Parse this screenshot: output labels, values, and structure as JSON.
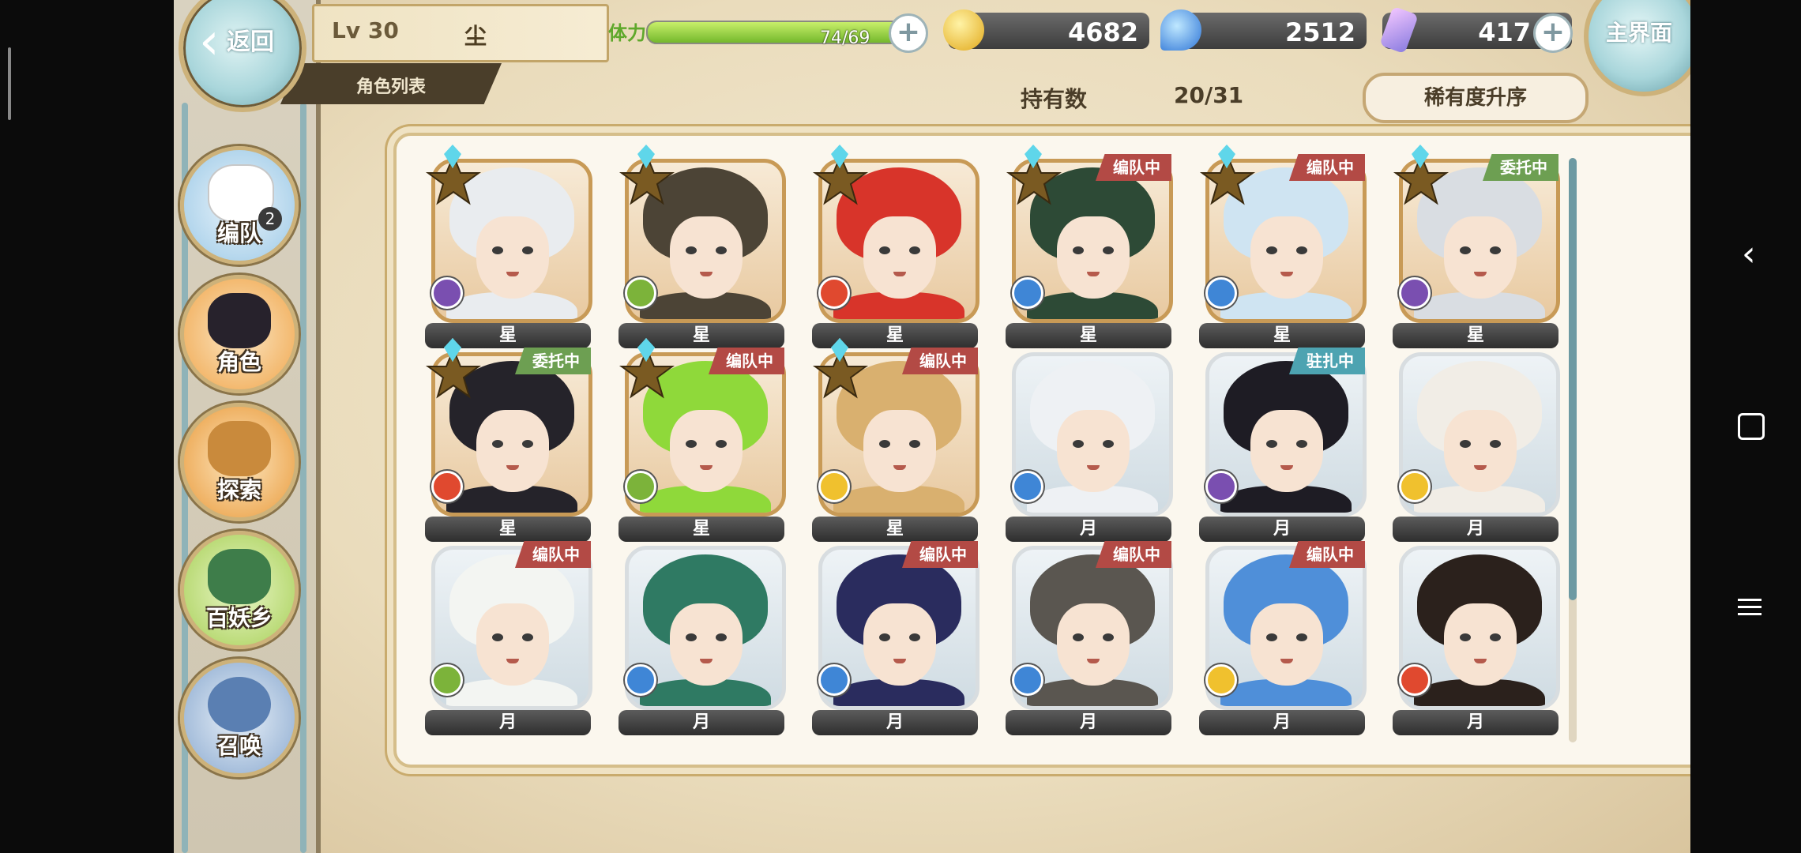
{
  "header": {
    "back_label": "返回",
    "home_label": "主界面",
    "level": "Lv 30",
    "player_name": "尘",
    "section_title": "角色列表",
    "stamina_label": "体力",
    "stamina_value": "74/69",
    "stamina_fraction": 0.93,
    "gold": "4682",
    "spirit": "2512",
    "crystal": "417"
  },
  "toolbar": {
    "owned_label": "持有数",
    "owned_value": "20/31",
    "sort_label": "稀有度升序"
  },
  "menu": [
    {
      "label": "编队",
      "badge": "2"
    },
    {
      "label": "角色"
    },
    {
      "label": "探索"
    },
    {
      "label": "百妖乡"
    },
    {
      "label": "召唤"
    }
  ],
  "characters": [
    {
      "rarity": "星",
      "status": "",
      "element": "purple",
      "hair": "#e9ecef",
      "star": true
    },
    {
      "rarity": "星",
      "status": "",
      "element": "green",
      "hair": "#4c4436",
      "star": true
    },
    {
      "rarity": "星",
      "status": "",
      "element": "red",
      "hair": "#d8342a",
      "star": true
    },
    {
      "rarity": "星",
      "status": "编队中",
      "status_type": "team",
      "element": "blue",
      "hair": "#2d4a36",
      "star": true
    },
    {
      "rarity": "星",
      "status": "编队中",
      "status_type": "team",
      "element": "blue",
      "hair": "#cfe4f2",
      "star": true
    },
    {
      "rarity": "星",
      "status": "委托中",
      "status_type": "commission",
      "element": "purple",
      "hair": "#d9dde2",
      "star": true
    },
    {
      "rarity": "星",
      "status": "委托中",
      "status_type": "commission",
      "element": "red",
      "hair": "#25232a",
      "star": true
    },
    {
      "rarity": "星",
      "status": "编队中",
      "status_type": "team",
      "element": "green",
      "hair": "#8fd93a",
      "star": true
    },
    {
      "rarity": "星",
      "status": "编队中",
      "status_type": "team",
      "element": "yellow",
      "hair": "#d9b06f",
      "star": true
    },
    {
      "rarity": "月",
      "status": "",
      "element": "blue",
      "hair": "#eef1f4",
      "star": false
    },
    {
      "rarity": "月",
      "status": "驻扎中",
      "status_type": "station",
      "element": "purple",
      "hair": "#1e1c24",
      "star": false
    },
    {
      "rarity": "月",
      "status": "",
      "element": "yellow",
      "hair": "#f1ede6",
      "star": false
    },
    {
      "rarity": "月",
      "status": "编队中",
      "status_type": "team",
      "element": "green",
      "hair": "#f3f5f2",
      "star": false
    },
    {
      "rarity": "月",
      "status": "",
      "element": "blue",
      "hair": "#2f7a63",
      "star": false
    },
    {
      "rarity": "月",
      "status": "编队中",
      "status_type": "team",
      "element": "blue",
      "hair": "#2a2c5e",
      "star": false
    },
    {
      "rarity": "月",
      "status": "编队中",
      "status_type": "team",
      "element": "blue",
      "hair": "#5a5650",
      "star": false
    },
    {
      "rarity": "月",
      "status": "编队中",
      "status_type": "team",
      "element": "yellow",
      "hair": "#4f8fd9",
      "star": false
    },
    {
      "rarity": "月",
      "status": "",
      "element": "red",
      "hair": "#2b211c",
      "star": false
    }
  ],
  "colors": {
    "element_purple": "#7a4fb0",
    "element_green": "#7cb33a",
    "element_red": "#e0492f",
    "element_blue": "#3f86d6",
    "element_yellow": "#f0c12e"
  }
}
